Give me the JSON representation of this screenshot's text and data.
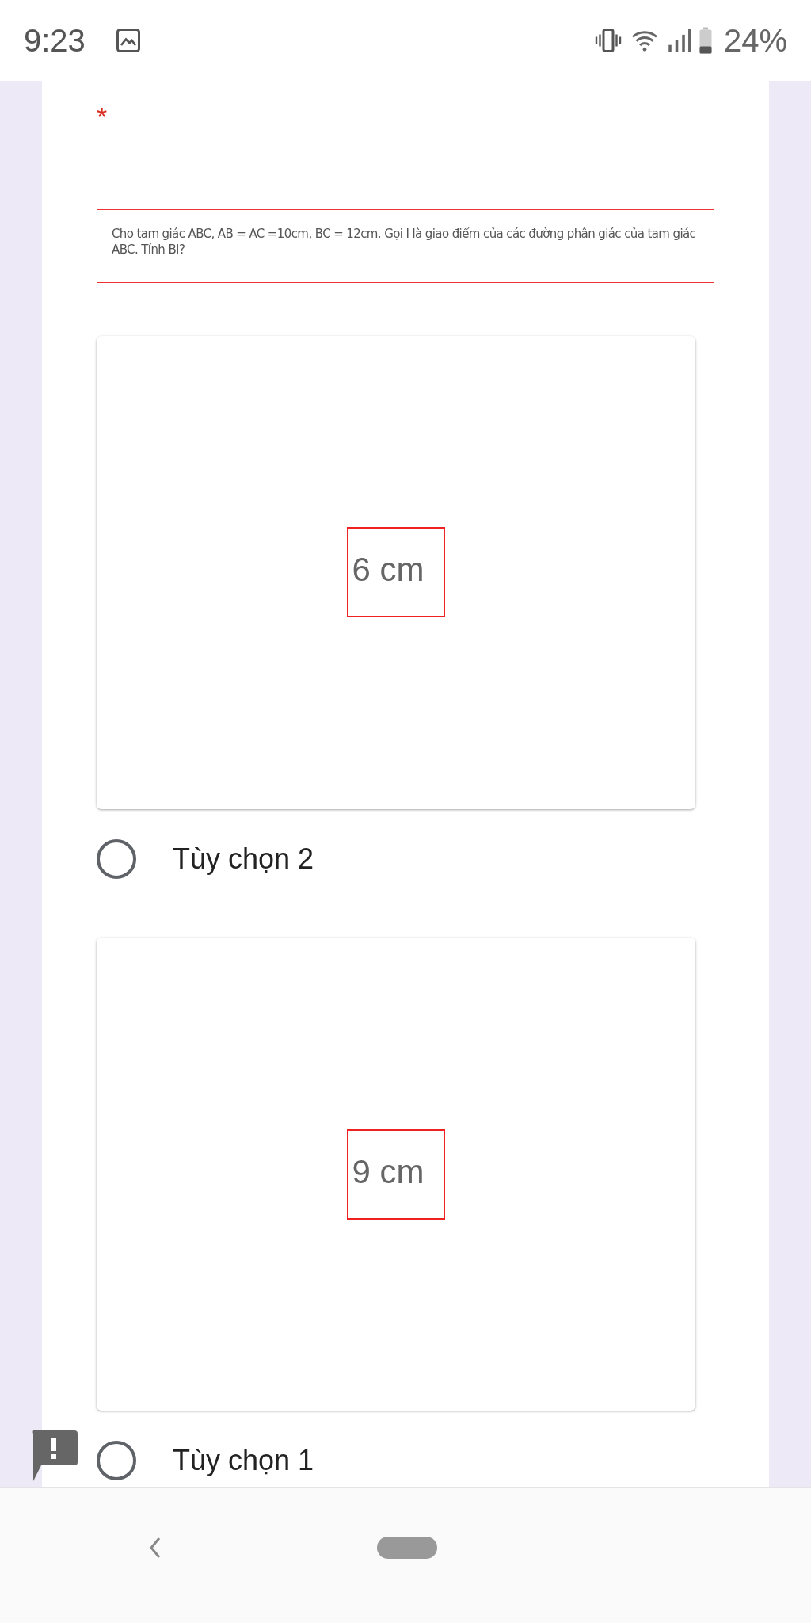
{
  "status_bar": {
    "time": "9:23",
    "battery": "24%"
  },
  "question": {
    "required_mark": "*",
    "image_text": "Cho tam giác ABC, AB = AC =10cm, BC = 12cm. Gọi I là giao điểm của các đường phân giác của tam giác ABC. Tính BI?"
  },
  "options": [
    {
      "image_text": "6 cm",
      "label": "Tùy chọn 2",
      "selected": false
    },
    {
      "image_text": "9 cm",
      "label": "Tùy chọn 1",
      "selected": false
    }
  ]
}
